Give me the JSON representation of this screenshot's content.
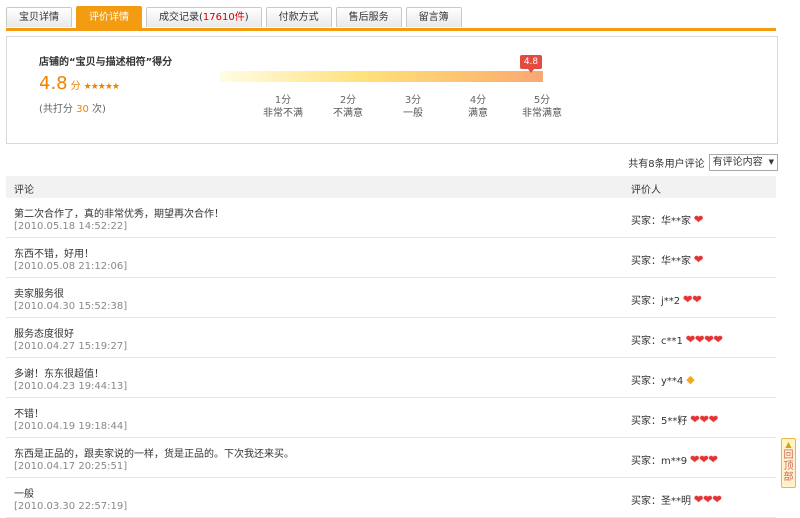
{
  "tabs": [
    {
      "label": "宝贝详情"
    },
    {
      "label": "评价详情",
      "active": true
    },
    {
      "label_prefix": "成交记录(",
      "count": "17610件",
      "label_suffix": ")"
    },
    {
      "label": "付款方式"
    },
    {
      "label": "售后服务"
    },
    {
      "label": "留言簿"
    }
  ],
  "score": {
    "title": "店铺的“宝贝与描述相符”得分",
    "value": "4.8",
    "unit": "分",
    "stars": "★★★★★",
    "rater_prefix": "(共打分 ",
    "rater_count": "30",
    "rater_suffix": " 次)",
    "bubble": "4.8",
    "ticks": [
      {
        "value": "1分",
        "label": "非常不满"
      },
      {
        "value": "2分",
        "label": "不满意"
      },
      {
        "value": "3分",
        "label": "一般"
      },
      {
        "value": "4分",
        "label": "满意"
      },
      {
        "value": "5分",
        "label": "非常满意"
      }
    ]
  },
  "filter": {
    "summary": "共有8条用户评论",
    "select_value": "有评论内容"
  },
  "table": {
    "col_comment": "评论",
    "col_reviewer": "评价人"
  },
  "reviews": [
    {
      "text": "第二次合作了，真的非常优秀，期望再次合作！",
      "date": "[2010.05.18 14:52:22]",
      "buyer": "买家：华**家",
      "icon": "heart",
      "count": 1
    },
    {
      "text": "东西不错，好用！",
      "date": "[2010.05.08 21:12:06]",
      "buyer": "买家：华**家",
      "icon": "heart",
      "count": 1
    },
    {
      "text": "卖家服务很",
      "date": "[2010.04.30 15:52:38]",
      "buyer": "买家：j**2",
      "icon": "heart",
      "count": 2
    },
    {
      "text": "服务态度很好",
      "date": "[2010.04.27 15:19:27]",
      "buyer": "买家：c**1",
      "icon": "heart",
      "count": 4
    },
    {
      "text": "多谢！东东很超值！",
      "date": "[2010.04.23 19:44:13]",
      "buyer": "买家：y**4",
      "icon": "diamond",
      "count": 1
    },
    {
      "text": "不错！",
      "date": "[2010.04.19 19:18:44]",
      "buyer": "买家：5**籽",
      "icon": "heart",
      "count": 3
    },
    {
      "text": "东西是正品的，跟卖家说的一样，货是正品的。下次我还来买。",
      "date": "[2010.04.17 20:25:51]",
      "buyer": "买家：m**9",
      "icon": "heart",
      "count": 3
    },
    {
      "text": "一般",
      "date": "[2010.03.30 22:57:19]",
      "buyer": "买家：圣**明",
      "icon": "heart",
      "count": 3
    }
  ],
  "back_to_top": "回顶部",
  "colors": {
    "accent": "#f39c12",
    "score": "#f08200",
    "heart": "#e83232"
  }
}
